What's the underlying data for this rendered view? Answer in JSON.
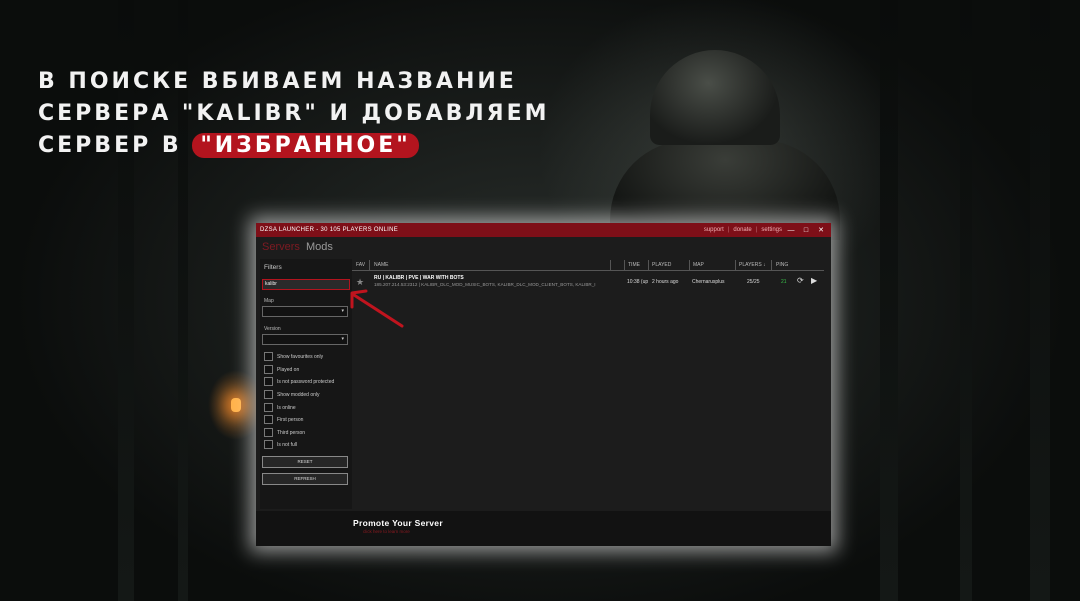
{
  "headline": {
    "line1": "В ПОИСКЕ ВБИВАЕМ НАЗВАНИЕ",
    "line2": "СЕРВЕРА \"KALIBR\" И ДОБАВЛЯЕМ",
    "line3_prefix": "СЕРВЕР В ",
    "line3_highlight": "\"ИЗБРАННОЕ\""
  },
  "window": {
    "title": "DZSA LAUNCHER - 30 105 PLAYERS ONLINE",
    "links": {
      "support": "support",
      "donate": "donate",
      "settings": "settings",
      "sep": "|"
    },
    "buttons": {
      "minimize": "—",
      "maximize": "□",
      "close": "✕"
    }
  },
  "tabs": {
    "servers": "Servers",
    "mods": "Mods"
  },
  "filters": {
    "title": "Filters",
    "search_value": "kalibr",
    "map_label": "Map",
    "map_value": "",
    "version_label": "Version",
    "version_value": "",
    "caret": "▾",
    "checkboxes": [
      "Show favourites only",
      "Played on",
      "Is not password protected",
      "Show modded only",
      "Is online",
      "First person",
      "Third person",
      "Is not full"
    ],
    "reset": "RESET",
    "refresh": "REFRESH"
  },
  "columns": {
    "fav": "FAV",
    "name": "NAME",
    "time": "TIME",
    "played": "PLAYED",
    "map": "MAP",
    "players": "PLAYERS ↓",
    "ping": "PING"
  },
  "server": {
    "name": "RU | KALIBR | PVE | WAR WITH BOTS",
    "details": "185.207.214.53:2312 | KALIBR_DLC_MOD_MUSIC_BOTS, KALIBR_DLC_MOD_CLIENT_BOTS, KALIBR_I",
    "time": "10:38 (up",
    "played": "2 hours ago",
    "map": "Chernarusplus",
    "players": "25/25",
    "ping": "21"
  },
  "icons": {
    "star": "star-icon",
    "refresh": "refresh-icon",
    "play": "play-icon"
  },
  "promo": {
    "title": "Promote Your Server",
    "subtitle": "click here to learn more"
  },
  "colors": {
    "accent": "#7e0f18",
    "highlight": "#b3141e",
    "ping": "#39c04a"
  }
}
